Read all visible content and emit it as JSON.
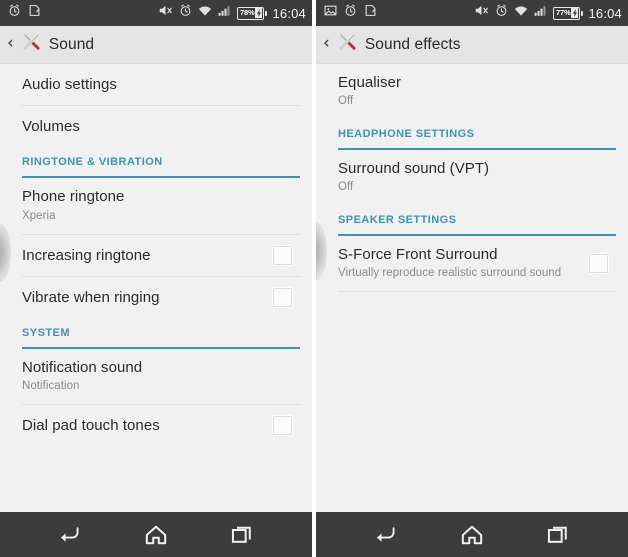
{
  "screens": [
    {
      "name": "sound-settings",
      "statusbar": {
        "left_icons": [
          "alarm-clock-icon",
          "note-icon"
        ],
        "right_icons": [
          "mute-icon",
          "alarm-clock-icon",
          "wifi-icon",
          "signal-icon"
        ],
        "battery_percent": "78%",
        "clock": "16:04"
      },
      "actionbar": {
        "back_label": "‹",
        "icon": "settings-tools-icon",
        "title": "Sound"
      },
      "items": [
        {
          "type": "row",
          "title": "Audio settings",
          "subtitle": "",
          "checkbox": false,
          "divider": true
        },
        {
          "type": "row",
          "title": "Volumes",
          "subtitle": "",
          "checkbox": false,
          "divider": false
        },
        {
          "type": "section",
          "title": "RINGTONE & VIBRATION"
        },
        {
          "type": "row",
          "title": "Phone ringtone",
          "subtitle": "Xperia",
          "checkbox": false,
          "divider": true
        },
        {
          "type": "row",
          "title": "Increasing ringtone",
          "subtitle": "",
          "checkbox": true,
          "divider": true
        },
        {
          "type": "row",
          "title": "Vibrate when ringing",
          "subtitle": "",
          "checkbox": true,
          "divider": false
        },
        {
          "type": "section",
          "title": "SYSTEM"
        },
        {
          "type": "row",
          "title": "Notification sound",
          "subtitle": "Notification",
          "checkbox": false,
          "divider": true
        },
        {
          "type": "row",
          "title": "Dial pad touch tones",
          "subtitle": "",
          "checkbox": true,
          "divider": false
        }
      ],
      "navbar": [
        "back-icon",
        "home-icon",
        "recents-icon"
      ]
    },
    {
      "name": "sound-effects-settings",
      "statusbar": {
        "left_icons": [
          "image-icon",
          "alarm-clock-icon",
          "note-icon"
        ],
        "right_icons": [
          "mute-icon",
          "alarm-clock-icon",
          "wifi-icon",
          "signal-icon"
        ],
        "battery_percent": "77%",
        "clock": "16:04"
      },
      "actionbar": {
        "back_label": "‹",
        "icon": "settings-tools-icon",
        "title": "Sound effects"
      },
      "items": [
        {
          "type": "row",
          "title": "Equaliser",
          "subtitle": "Off",
          "checkbox": false,
          "divider": false
        },
        {
          "type": "section",
          "title": "HEADPHONE SETTINGS"
        },
        {
          "type": "row",
          "title": "Surround sound (VPT)",
          "subtitle": "Off",
          "checkbox": false,
          "divider": false
        },
        {
          "type": "section",
          "title": "SPEAKER SETTINGS"
        },
        {
          "type": "row",
          "title": "S-Force Front Surround",
          "subtitle": "Virtually reproduce realistic surround sound",
          "checkbox": true,
          "divider": true
        }
      ],
      "navbar": [
        "back-icon",
        "home-icon",
        "recents-icon"
      ]
    }
  ],
  "colors": {
    "accent": "#3f93b5",
    "statusbar_bg": "#3c3c3c",
    "actionbar_bg": "#e4e4e4",
    "list_bg": "#f1f1f1",
    "title_text": "#2b2b2b",
    "subtitle_text": "#8a8a8a"
  }
}
